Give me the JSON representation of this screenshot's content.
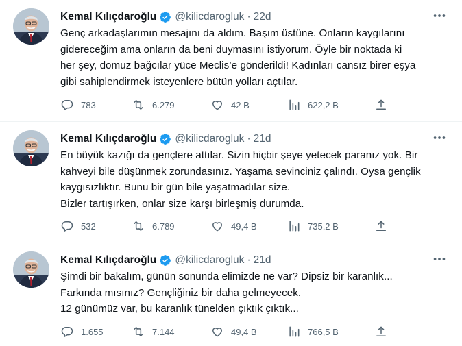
{
  "tweets": [
    {
      "author_name": "Kemal Kılıçdaroğlu",
      "handle": "@kilicdarogluk",
      "separator": "·",
      "time": "22d",
      "lines": [
        "Genç arkadaşlarımın mesajını da aldım. Başım üstüne. Onların kaygılarını",
        "gidereceğim ama onların da beni duymasını istiyorum. Öyle bir noktada ki",
        "her şey, domuz bağcılar yüce Meclis’e gönderildi! Kadınları cansız birer eşya",
        "gibi sahiplendirmek isteyenlere bütün yolları açtılar."
      ],
      "replies": "783",
      "retweets": "6.279",
      "likes": "42 B",
      "views": "622,2 B"
    },
    {
      "author_name": "Kemal Kılıçdaroğlu",
      "handle": "@kilicdarogluk",
      "separator": "·",
      "time": "21d",
      "lines": [
        "En büyük kazığı da gençlere attılar. Sizin hiçbir şeye yetecek paranız yok. Bir",
        "kahveyi bile düşünmek zorundasınız. Yaşama sevinciniz çalındı. Oysa gençlik",
        "kaygısızlıktır. Bunu bir gün bile yaşatmadılar size.",
        "Bizler tartışırken, onlar size karşı birleşmiş durumda."
      ],
      "replies": "532",
      "retweets": "6.789",
      "likes": "49,4 B",
      "views": "735,2 B"
    },
    {
      "author_name": "Kemal Kılıçdaroğlu",
      "handle": "@kilicdarogluk",
      "separator": "·",
      "time": "21d",
      "lines": [
        "Şimdi bir bakalım, günün sonunda elimizde ne var?  Dipsiz bir karanlık...",
        "Farkında mısınız? Gençliğiniz bir daha gelmeyecek.",
        "12 günümüz var, bu karanlık tünelden çıktık çıktık..."
      ],
      "replies": "1.655",
      "retweets": "7.144",
      "likes": "49,4 B",
      "views": "766,5 B"
    }
  ],
  "icons": {
    "verified": "verified-badge-icon",
    "more": "more-icon",
    "reply": "reply-icon",
    "retweet": "retweet-icon",
    "like": "heart-icon",
    "views": "views-icon",
    "share": "share-icon"
  },
  "colors": {
    "verified": "#1d9bf0",
    "secondary_text": "#536471",
    "primary_text": "#0f1419"
  }
}
